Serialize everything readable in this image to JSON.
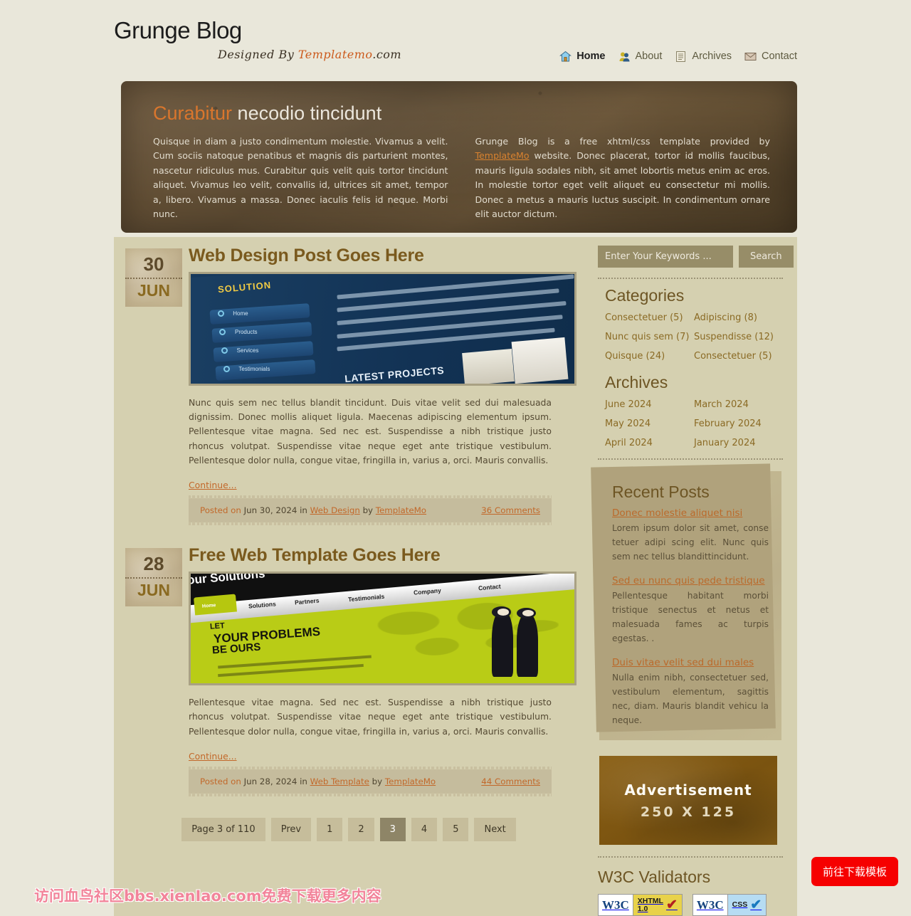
{
  "site": {
    "logo": "Grunge Blog",
    "tagline_prefix": "Designed By ",
    "tagline_brand": "Templatemo",
    "tagline_suffix": ".com"
  },
  "nav": [
    {
      "label": "Home",
      "icon": "house-icon",
      "active": true
    },
    {
      "label": "About",
      "icon": "people-icon",
      "active": false
    },
    {
      "label": "Archives",
      "icon": "document-icon",
      "active": false
    },
    {
      "label": "Contact",
      "icon": "envelope-icon",
      "active": false
    }
  ],
  "banner": {
    "title_highlight": "Curabitur",
    "title_rest": " necodio tincidunt",
    "left_text": "Quisque in diam a justo condimentum molestie. Vivamus a velit. Cum sociis natoque penatibus et magnis dis parturient montes, nascetur ridiculus mus. Curabitur quis velit quis tortor tincidunt aliquet. Vivamus leo velit, convallis id, ultrices sit amet, tempor a, libero. Vivamus a massa. Donec iaculis felis id neque. Morbi nunc.",
    "right_text_a": "Grunge Blog is a free xhtml/css template provided by ",
    "right_link": "TemplateMo",
    "right_text_b": " website. Donec placerat, tortor id mollis faucibus, mauris ligula sodales nibh, sit amet lobortis metus enim ac eros. In molestie tortor eget velit aliquet eu consectetur mi mollis. Donec a metus a mauris luctus suscipit. In condimentum ornare elit auctor dictum."
  },
  "posts": [
    {
      "day": "30",
      "month": "JUN",
      "title": "Web Design Post Goes Here",
      "thumb": "blue-website-screenshot",
      "body": "Nunc quis sem nec tellus blandit tincidunt. Duis vitae velit sed dui malesuada dignissim. Donec mollis aliquet ligula. Maecenas adipiscing elementum ipsum. Pellentesque vitae magna. Sed nec est. Suspendisse a nibh tristique justo rhoncus volutpat. Suspendisse vitae neque eget ante tristique vestibulum. Pellentesque dolor nulla, congue vitae, fringilla in, varius a, orci. Mauris convallis.",
      "continue": "Continue...",
      "posted_label": "Posted on",
      "date": "Jun 30, 2024",
      "in_label": "in",
      "category": "Web Design",
      "by_label": "by",
      "author": "TemplateMo",
      "comments": "36 Comments"
    },
    {
      "day": "28",
      "month": "JUN",
      "title": "Free Web Template Goes Here",
      "thumb": "green-website-screenshot",
      "body": "Pellentesque vitae magna. Sed nec est. Suspendisse a nibh tristique justo rhoncus volutpat. Suspendisse vitae neque eget ante tristique vestibulum. Pellentesque dolor nulla, congue vitae, fringilla in, varius a, orci. Mauris convallis.",
      "continue": "Continue...",
      "posted_label": "Posted on",
      "date": "Jun 28, 2024",
      "in_label": "in",
      "category": "Web Template",
      "by_label": "by",
      "author": "TemplateMo",
      "comments": "44 Comments"
    }
  ],
  "pagination": {
    "info": "Page 3 of 110",
    "prev": "Prev",
    "next": "Next",
    "pages": [
      "1",
      "2",
      "3",
      "4",
      "5"
    ],
    "current": "3"
  },
  "sidebar": {
    "search": {
      "placeholder": "Enter Your Keywords ...",
      "value": "",
      "button": "Search"
    },
    "categories": {
      "title": "Categories",
      "col1": [
        "Consectetuer (5)",
        "Nunc quis sem (7)",
        "Quisque (24)"
      ],
      "col2": [
        "Adipiscing (8)",
        "Suspendisse (12)",
        "Consectetuer (5)"
      ]
    },
    "archives": {
      "title": "Archives",
      "col1": [
        "June 2024",
        "May 2024",
        "April 2024"
      ],
      "col2": [
        "March 2024",
        "February 2024",
        "January 2024"
      ]
    },
    "recent_posts": {
      "title": "Recent Posts",
      "items": [
        {
          "link": "Donec molestie aliquet nisi",
          "text": "Lorem ipsum dolor sit amet, conse tetuer adipi scing elit. Nunc quis sem nec tellus blandittincidunt."
        },
        {
          "link": "Sed eu nunc quis pede tristique",
          "text": "Pellentesque habitant morbi tristique senectus et netus et malesuada fames ac turpis egestas. ."
        },
        {
          "link": "Duis vitae velit sed dui males",
          "text": "Nulla enim nibh, consectetuer sed, vestibulum elementum, sagittis nec, diam. Mauris blandit vehicu la neque."
        }
      ]
    },
    "advertisement": {
      "line1": "Advertisement",
      "line2": "250 X 125"
    },
    "w3c": {
      "title": "W3C Validators",
      "badges": [
        {
          "left": "W3C",
          "right_top": "XHTML",
          "right_bottom": "1.0"
        },
        {
          "left": "W3C",
          "right_top": "CSS",
          "right_bottom": ""
        }
      ]
    }
  },
  "overlay": {
    "watermark": "访问血鸟社区bbs.xienIao.com免费下载更多内容",
    "download_button": "前往下载模板"
  },
  "colors": {
    "page_bg": "#e9e7da",
    "content_bg": "#d5d0b0",
    "accent_orange": "#c2682a",
    "heading_brown": "#7a5a1e",
    "banner_brown": "#5c4a32",
    "button_red": "#f60000"
  }
}
